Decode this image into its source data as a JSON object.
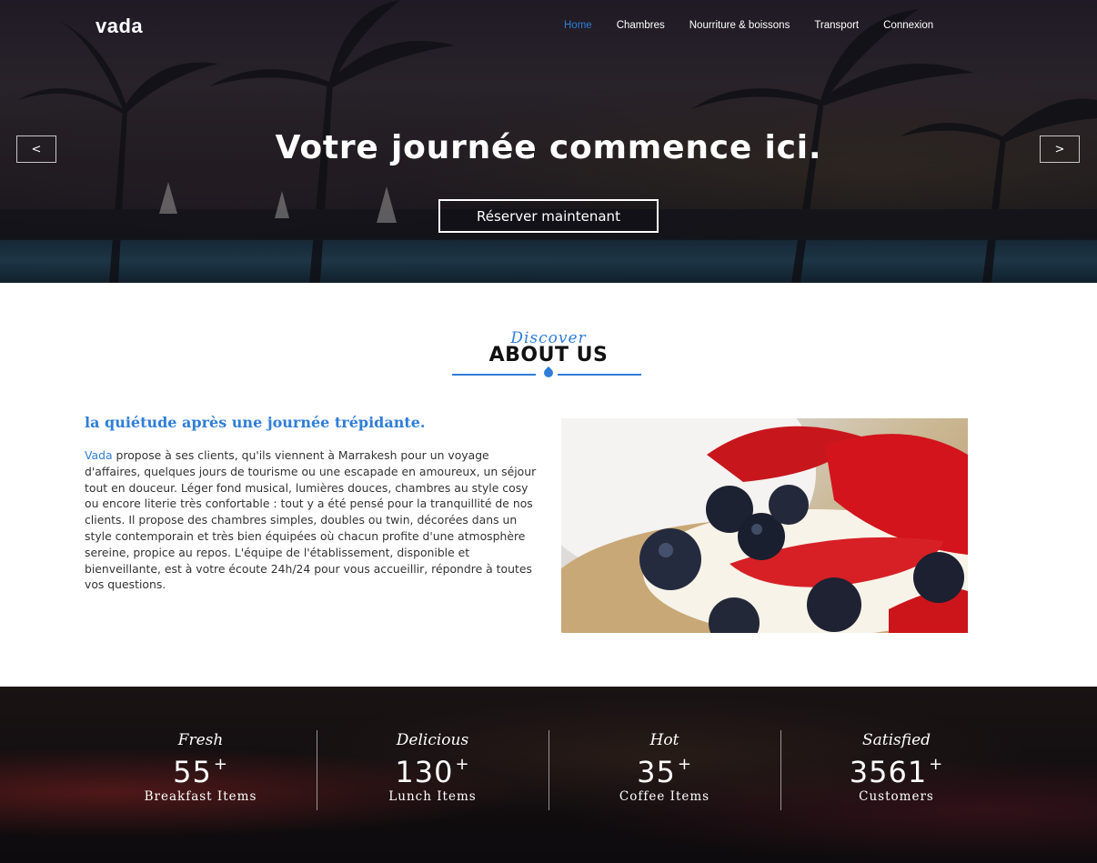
{
  "header": {
    "logo": "vada",
    "nav": [
      {
        "label": "Home",
        "active": true
      },
      {
        "label": "Chambres",
        "active": false
      },
      {
        "label": "Nourriture & boissons",
        "active": false
      },
      {
        "label": "Transport",
        "active": false
      },
      {
        "label": "Connexion",
        "active": false
      }
    ]
  },
  "hero": {
    "title": "Votre journée commence ici.",
    "button": "Réserver maintenant",
    "prev_label": "<",
    "next_label": ">"
  },
  "about": {
    "script": "Discover",
    "title": "ABOUT US",
    "subtitle": "la quiétude après une journée trépidante.",
    "brand": "Vada",
    "text": " propose à ses clients, qu'ils viennent à Marrakesh pour un voyage d'affaires, quelques jours de tourisme ou une escapade en amoureux, un séjour tout en douceur. Léger fond musical, lumières douces, chambres au style cosy ou encore literie très confortable : tout y a été pensé pour la tranquillité de nos clients. Il propose des chambres simples, doubles ou twin, décorées dans un style contemporain et très bien équipées où chacun profite d'une atmosphère sereine, propice au repos. L'équipe de l'établissement, disponible et bienveillante, est à votre écoute 24h/24 pour vous accueillir, répondre à toutes vos questions."
  },
  "counters": [
    {
      "script": "Fresh",
      "number": "55",
      "suffix": "+",
      "label": "Breakfast Items"
    },
    {
      "script": "Delicious",
      "number": "130",
      "suffix": "+",
      "label": "Lunch Items"
    },
    {
      "script": "Hot",
      "number": "35",
      "suffix": "+",
      "label": "Coffee Items"
    },
    {
      "script": "Satisfied",
      "number": "3561",
      "suffix": "+",
      "label": "Customers"
    }
  ],
  "colors": {
    "accent": "#2f7ed8",
    "hero_text": "#ffffff"
  }
}
